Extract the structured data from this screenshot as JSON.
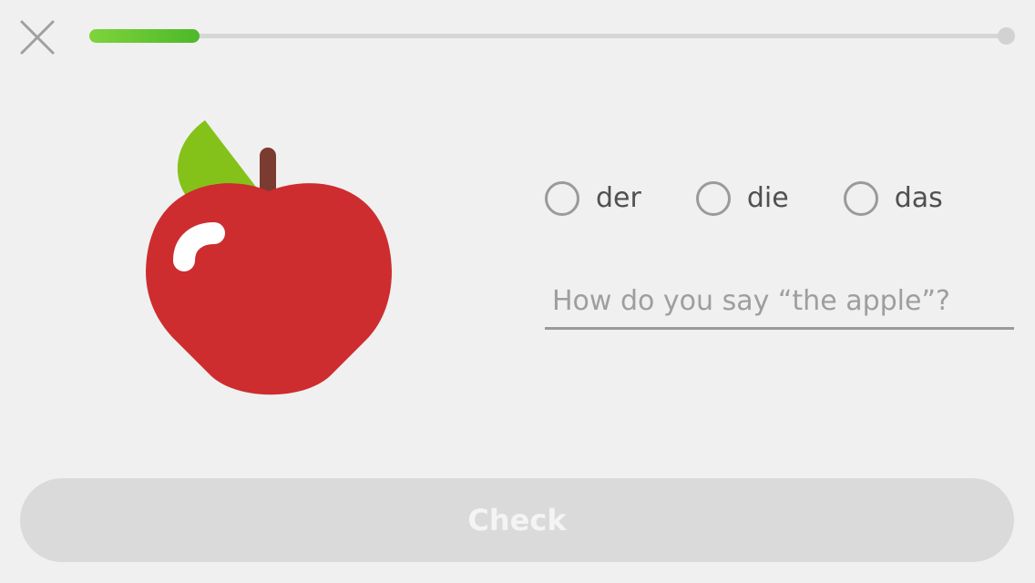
{
  "header": {
    "close_icon": "close-icon",
    "progress_fraction": 0.12,
    "progress_color": "#58cc02"
  },
  "illustration": {
    "icon": "apple-icon",
    "colors": {
      "apple": "#cd2d2f",
      "leaf": "#84c219",
      "stem": "#7b3b30",
      "shine": "#ffffff"
    }
  },
  "options": [
    {
      "label": "der"
    },
    {
      "label": "die"
    },
    {
      "label": "das"
    }
  ],
  "answer": {
    "placeholder": "How do you say “the apple”?",
    "value": ""
  },
  "footer": {
    "check_label": "Check",
    "disabled_color": "#dadada"
  }
}
